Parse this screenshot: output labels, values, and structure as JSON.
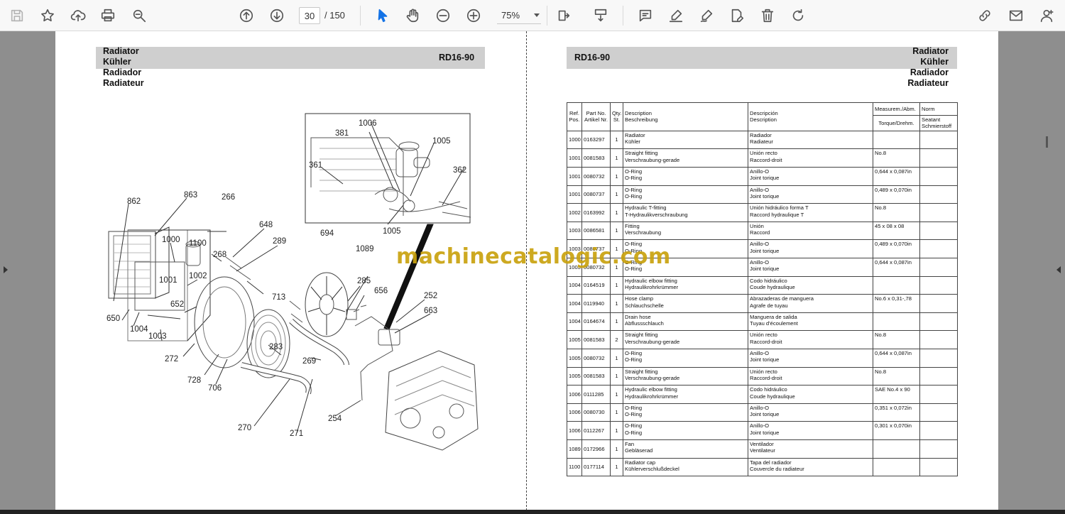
{
  "toolbar": {
    "current_page": "30",
    "page_total": "/ 150",
    "zoom": "75%"
  },
  "left_page": {
    "title_lines": [
      "Radiator",
      "Kühler",
      "Radiador",
      "Radiateur"
    ],
    "code": "RD16-90",
    "callouts": [
      "1006",
      "381",
      "1005",
      "361",
      "362",
      "694",
      "1005",
      "862",
      "863",
      "266",
      "648",
      "289",
      "1000",
      "1100",
      "268",
      "1089",
      "1001",
      "1002",
      "713",
      "285",
      "656",
      "252",
      "663",
      "652",
      "650",
      "1004",
      "1003",
      "272",
      "283",
      "269",
      "728",
      "706",
      "270",
      "271",
      "254"
    ]
  },
  "right_page": {
    "title_lines": [
      "Radiator",
      "Kühler",
      "Radiador",
      "Radiateur"
    ],
    "code": "RD16-90",
    "table_headers": {
      "ref": [
        "Ref.",
        "Pos."
      ],
      "part": [
        "Part No.",
        "Artikel Nr."
      ],
      "qty": [
        "Qty.",
        "St."
      ],
      "desc": [
        "Description",
        "Beschreibung"
      ],
      "desc2": [
        "Descripción",
        "Description"
      ],
      "measure_top": "Measurem./Abm.",
      "measure_bottom": "Torque/Drehm.",
      "norm_top": "Norm",
      "norm_bottom": [
        "Seatant",
        "Schmierstoff"
      ]
    },
    "rows": [
      {
        "ref": "1000",
        "part": "0163297",
        "qty": "1",
        "d1": "Radiator",
        "d2": "Kühler",
        "e1": "Radiador",
        "e2": "Radiateur",
        "m": ""
      },
      {
        "ref": "1001",
        "part": "0081583",
        "qty": "1",
        "d1": "Straight fitting",
        "d2": "Verschraubung-gerade",
        "e1": "Unión recto",
        "e2": "Raccord-droit",
        "m": "No.8"
      },
      {
        "ref": "1001",
        "part": "0080732",
        "qty": "1",
        "d1": "O-Ring",
        "d2": "O-Ring",
        "e1": "Anillo-O",
        "e2": "Joint torique",
        "m": "0,644 x 0,087in"
      },
      {
        "ref": "1001",
        "part": "0080737",
        "qty": "1",
        "d1": "O-Ring",
        "d2": "O-Ring",
        "e1": "Anillo-O",
        "e2": "Joint torique",
        "m": "0,489 x 0,070in"
      },
      {
        "ref": "1002",
        "part": "0163992",
        "qty": "1",
        "d1": "Hydraulic T-fitting",
        "d2": "T-Hydraulikverschraubung",
        "e1": "Unión hidráulico forma T",
        "e2": "Raccord hydraulique T",
        "m": "No.8"
      },
      {
        "ref": "1003",
        "part": "0086581",
        "qty": "1",
        "d1": "Fitting",
        "d2": "Verschraubung",
        "e1": "Unión",
        "e2": "Raccord",
        "m": "45 x 08 x 08"
      },
      {
        "ref": "1003",
        "part": "0080737",
        "qty": "1",
        "d1": "O-Ring",
        "d2": "O-Ring",
        "e1": "Anillo-O",
        "e2": "Joint torique",
        "m": "0,489 x 0,070in"
      },
      {
        "ref": "1003",
        "part": "0080732",
        "qty": "1",
        "d1": "O-Ring",
        "d2": "O-Ring",
        "e1": "Anillo-O",
        "e2": "Joint torique",
        "m": "0,644 x 0,087in"
      },
      {
        "ref": "1004",
        "part": "0164519",
        "qty": "1",
        "d1": "Hydraulic elbow fitting",
        "d2": "Hydraulikrohrkrümmer",
        "e1": "Codo hidráulico",
        "e2": "Coude hydraulique",
        "m": ""
      },
      {
        "ref": "1004",
        "part": "0119940",
        "qty": "1",
        "d1": "Hose clamp",
        "d2": "Schlauchschelle",
        "e1": "Abrazaderas de manguera",
        "e2": "Agrafe de tuyau",
        "m": "No.6 x 0,31-,78"
      },
      {
        "ref": "1004",
        "part": "0164674",
        "qty": "1",
        "d1": "Drain hose",
        "d2": "Abflussschlauch",
        "e1": "Manguera de salida",
        "e2": "Tuyau d'écoulement",
        "m": ""
      },
      {
        "ref": "1005",
        "part": "0081583",
        "qty": "2",
        "d1": "Straight fitting",
        "d2": "Verschraubung-gerade",
        "e1": "Unión recto",
        "e2": "Raccord-droit",
        "m": "No.8"
      },
      {
        "ref": "1005",
        "part": "0080732",
        "qty": "1",
        "d1": "O-Ring",
        "d2": "O-Ring",
        "e1": "Anillo-O",
        "e2": "Joint torique",
        "m": "0,644 x 0,087in"
      },
      {
        "ref": "1005",
        "part": "0081583",
        "qty": "1",
        "d1": "Straight fitting",
        "d2": "Verschraubung-gerade",
        "e1": "Unión recto",
        "e2": "Raccord-droit",
        "m": "No.8"
      },
      {
        "ref": "1006",
        "part": "0111285",
        "qty": "1",
        "d1": "Hydraulic elbow fitting",
        "d2": "Hydraulikrohrkrümmer",
        "e1": "Codo hidráulico",
        "e2": "Coude hydraulique",
        "m": "SAE No.4 x 90"
      },
      {
        "ref": "1006",
        "part": "0080730",
        "qty": "1",
        "d1": "O-Ring",
        "d2": "O-Ring",
        "e1": "Anillo-O",
        "e2": "Joint torique",
        "m": "0,351 x 0,072in"
      },
      {
        "ref": "1006",
        "part": "0112267",
        "qty": "1",
        "d1": "O-Ring",
        "d2": "O-Ring",
        "e1": "Anillo-O",
        "e2": "Joint torique",
        "m": "0,301 x 0,070in"
      },
      {
        "ref": "1089",
        "part": "0172966",
        "qty": "1",
        "d1": "Fan",
        "d2": "Gebläserad",
        "e1": "Ventilador",
        "e2": "Ventilateur",
        "m": ""
      },
      {
        "ref": "1100",
        "part": "0177114",
        "qty": "1",
        "d1": "Radiator cap",
        "d2": "Kühlerverschlußdeckel",
        "e1": "Tapa del radiador",
        "e2": "Couvercle du radiateur",
        "m": ""
      }
    ]
  },
  "watermark": "machinecatalogic.com"
}
